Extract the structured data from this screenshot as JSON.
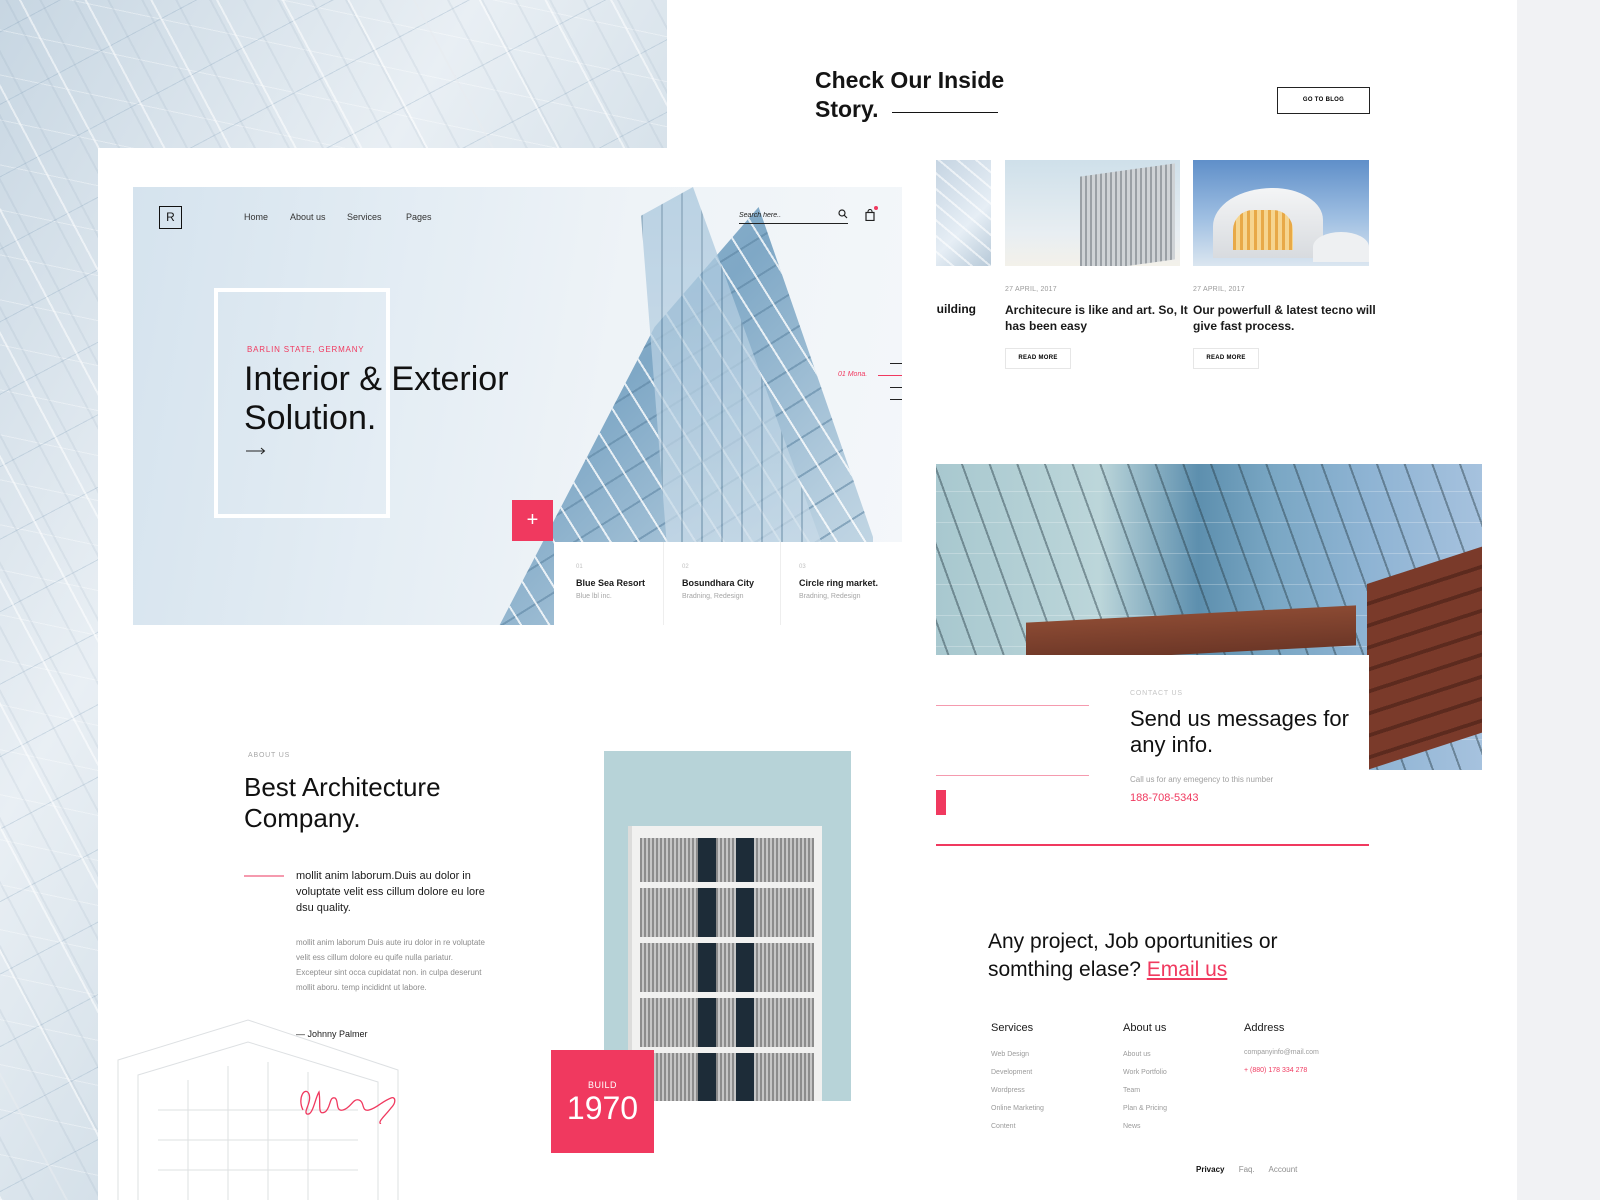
{
  "hero": {
    "logo": "R",
    "nav": [
      "Home",
      "About us",
      "Services",
      "Pages"
    ],
    "search_placeholder": "Search here..",
    "kicker": "BARLIN STATE, GERMANY",
    "title": "Interior & Exterior Solution.",
    "plus": "+",
    "slide_label": "01 Mona."
  },
  "projects": [
    {
      "num": "01",
      "title": "Blue Sea Resort",
      "sub": "Blue lbl inc."
    },
    {
      "num": "02",
      "title": "Bosundhara City",
      "sub": "Bradning, Redesign"
    },
    {
      "num": "03",
      "title": "Circle ring market.",
      "sub": "Bradning, Redesign"
    }
  ],
  "about": {
    "kicker": "ABOUT US",
    "title": "Best Architecture Company.",
    "lead": "mollit anim laborum.Duis au dolor in voluptate velit ess cillum dolore eu lore dsu quality.",
    "body": "mollit anim laborum Duis aute iru dolor in re voluptate velit ess cillum dolore eu quife nulla pariatur. Excepteur sint occa cupidatat non. in culpa deserunt mollit aboru. temp incididnt ut labore.",
    "author": "— Johnny Palmer",
    "build_label": "BUILD",
    "build_year": "1970"
  },
  "blog": {
    "title": "Check Our Inside Story.",
    "go_button": "GO TO BLOG",
    "cut_title": "uilding",
    "posts": [
      {
        "date": "27 APRIL, 2017",
        "title": "Architecure is like and art. So, It has been easy",
        "read_more": "READ MORE"
      },
      {
        "date": "27 APRIL, 2017",
        "title": "Our powerfull & latest tecno will give fast process.",
        "read_more": "READ MORE"
      }
    ]
  },
  "contact": {
    "kicker": "CONTACT US",
    "title": "Send us messages for any info.",
    "desc": "Call us for any emegency to this number",
    "phone": "188-708-5343"
  },
  "footer": {
    "cta_text": "Any project, Job oportunities or somthing elase?",
    "cta_link": "Email us",
    "columns": [
      {
        "title": "Services",
        "items": [
          "Web Design",
          "Development",
          "Wordpress",
          "Online Marketing",
          "Content"
        ]
      },
      {
        "title": "About us",
        "items": [
          "About us",
          "Work Portfolio",
          "Team",
          "Plan & Pricing",
          "News"
        ]
      },
      {
        "title": "Address",
        "items": [
          "companyinfo@mail.com",
          "+ (880) 178 334 278"
        ]
      }
    ],
    "links": [
      "Privacy",
      "Faq.",
      "Account"
    ]
  },
  "colors": {
    "accent": "#f0395f",
    "text": "#141414",
    "muted": "#9b9b9b"
  },
  "icons": [
    "search-icon",
    "shopping-bag-icon",
    "arrow-right-icon",
    "plus-icon",
    "signature-image"
  ]
}
